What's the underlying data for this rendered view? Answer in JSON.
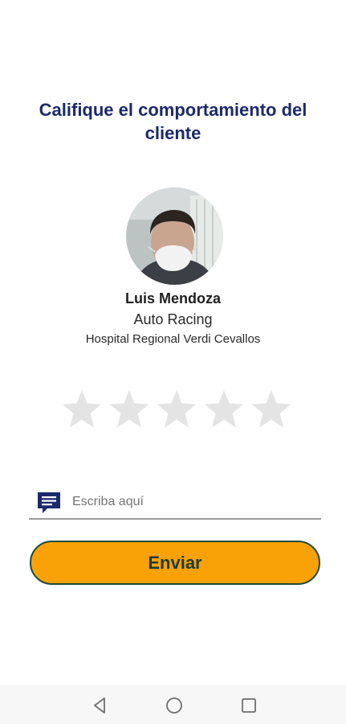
{
  "page": {
    "title": "Califique el comportamiento del cliente"
  },
  "client": {
    "name": "Luis Mendoza",
    "company": "Auto Racing",
    "location": "Hospital Regional Verdi Cevallos"
  },
  "rating": {
    "max": 5,
    "value": 0,
    "empty_color": "#e4e4e4"
  },
  "comment": {
    "placeholder": "Escriba aquí",
    "value": "",
    "icon": "comment-icon",
    "icon_color": "#1b2a6b"
  },
  "send_button": {
    "label": "Enviar",
    "background": "#f9a208"
  },
  "navigation": {
    "items": [
      {
        "name": "back",
        "icon": "triangle-back-icon"
      },
      {
        "name": "home",
        "icon": "circle-home-icon"
      },
      {
        "name": "recents",
        "icon": "square-recents-icon"
      }
    ]
  },
  "colors": {
    "title": "#1b2a6b",
    "accent": "#f9a208",
    "button_border": "#1e4a3d"
  }
}
